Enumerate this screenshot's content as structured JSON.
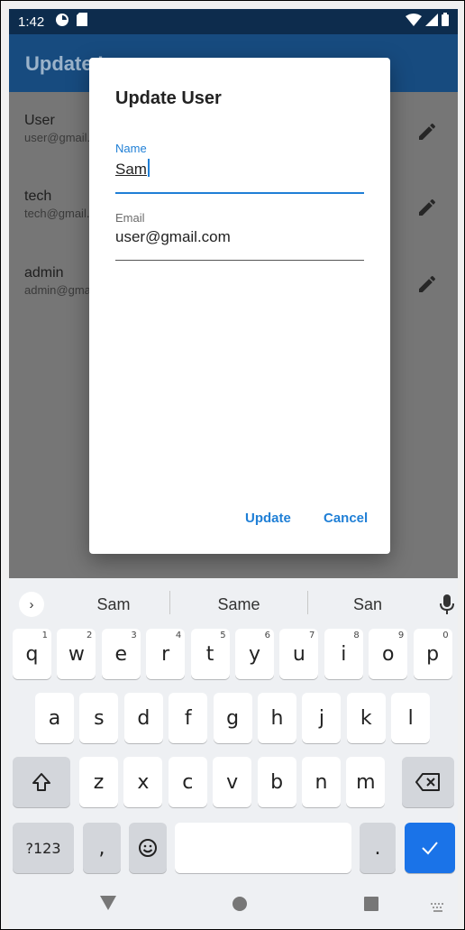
{
  "status_bar": {
    "time": "1:42"
  },
  "app_bar": {
    "title": "Update User"
  },
  "users": [
    {
      "name": "User",
      "email": "user@gmail.com"
    },
    {
      "name": "tech",
      "email": "tech@gmail.com"
    },
    {
      "name": "admin",
      "email": "admin@gmail.com"
    }
  ],
  "dialog": {
    "title": "Update User",
    "name_label": "Name",
    "name_value": "Sam",
    "email_label": "Email",
    "email_value": "user@gmail.com",
    "update_label": "Update",
    "cancel_label": "Cancel"
  },
  "keyboard": {
    "suggestions": [
      "Sam",
      "Same",
      "San"
    ],
    "row1": [
      {
        "k": "q",
        "h": "1"
      },
      {
        "k": "w",
        "h": "2"
      },
      {
        "k": "e",
        "h": "3"
      },
      {
        "k": "r",
        "h": "4"
      },
      {
        "k": "t",
        "h": "5"
      },
      {
        "k": "y",
        "h": "6"
      },
      {
        "k": "u",
        "h": "7"
      },
      {
        "k": "i",
        "h": "8"
      },
      {
        "k": "o",
        "h": "9"
      },
      {
        "k": "p",
        "h": "0"
      }
    ],
    "row2": [
      "a",
      "s",
      "d",
      "f",
      "g",
      "h",
      "j",
      "k",
      "l"
    ],
    "row3": [
      "z",
      "x",
      "c",
      "v",
      "b",
      "n",
      "m"
    ],
    "symbols_label": "?123",
    "comma_label": ",",
    "period_label": "."
  },
  "colors": {
    "accent": "#1f7fd6",
    "app_bar": "#174b7f",
    "status_bar": "#0d2c4d",
    "keyboard_enter": "#1a73e8"
  }
}
